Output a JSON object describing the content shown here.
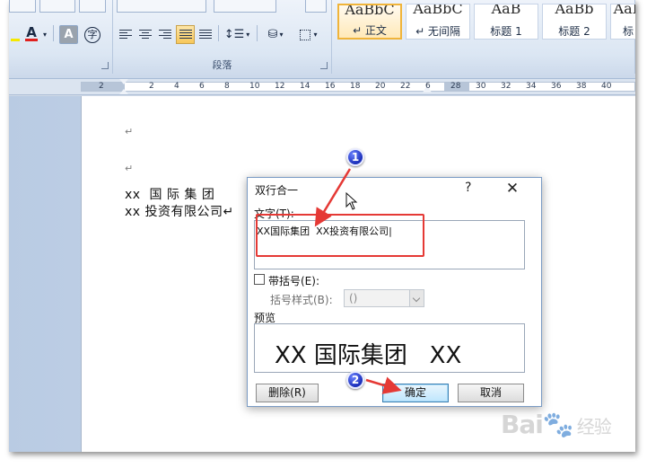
{
  "ribbon": {
    "font_tools": {
      "font_color_letter": "A",
      "char_shading_letter": "A",
      "enclose_char": "字"
    },
    "paragraph_group_label": "段落",
    "styles": [
      {
        "preview": "AaBbC",
        "name": "↵ 正文",
        "active": true
      },
      {
        "preview": "AaBbC",
        "name": "↵ 无间隔",
        "active": false
      },
      {
        "preview": "AaB",
        "name": "标题 1",
        "active": false
      },
      {
        "preview": "AaBb",
        "name": "标题 2",
        "active": false
      },
      {
        "preview": "AaB",
        "name": "标",
        "active": false
      }
    ]
  },
  "ruler": {
    "ticks": [
      "2",
      "2",
      "4",
      "6",
      "8",
      "10",
      "12",
      "14",
      "16",
      "18",
      "20",
      "22",
      "6",
      "28",
      "30",
      "32",
      "34",
      "36",
      "38",
      "40"
    ]
  },
  "document": {
    "para_mark": "↵",
    "line1": "xx  国 际 集 团",
    "line2": "xx 投资有限公司↵"
  },
  "dialog": {
    "title": "双行合一",
    "help": "?",
    "close": "✕",
    "text_label": "文字(T):",
    "text_value": "XX国际集团  XX投资有限公司|",
    "bracket_checkbox_label": "带括号(E):",
    "bracket_style_label": "括号样式(B):",
    "bracket_style_value": "()",
    "preview_label": "预览",
    "preview_text": "XX 国际集团   XX",
    "delete_button": "删除(R)",
    "ok_button": "确定",
    "cancel_button": "取消"
  },
  "annotations": {
    "badge1": "1",
    "badge2": "2",
    "highlight_color": "#e53935",
    "badge_color": "#1b2fb9"
  },
  "watermark": {
    "brand": "Bai",
    "sub": "经验"
  }
}
